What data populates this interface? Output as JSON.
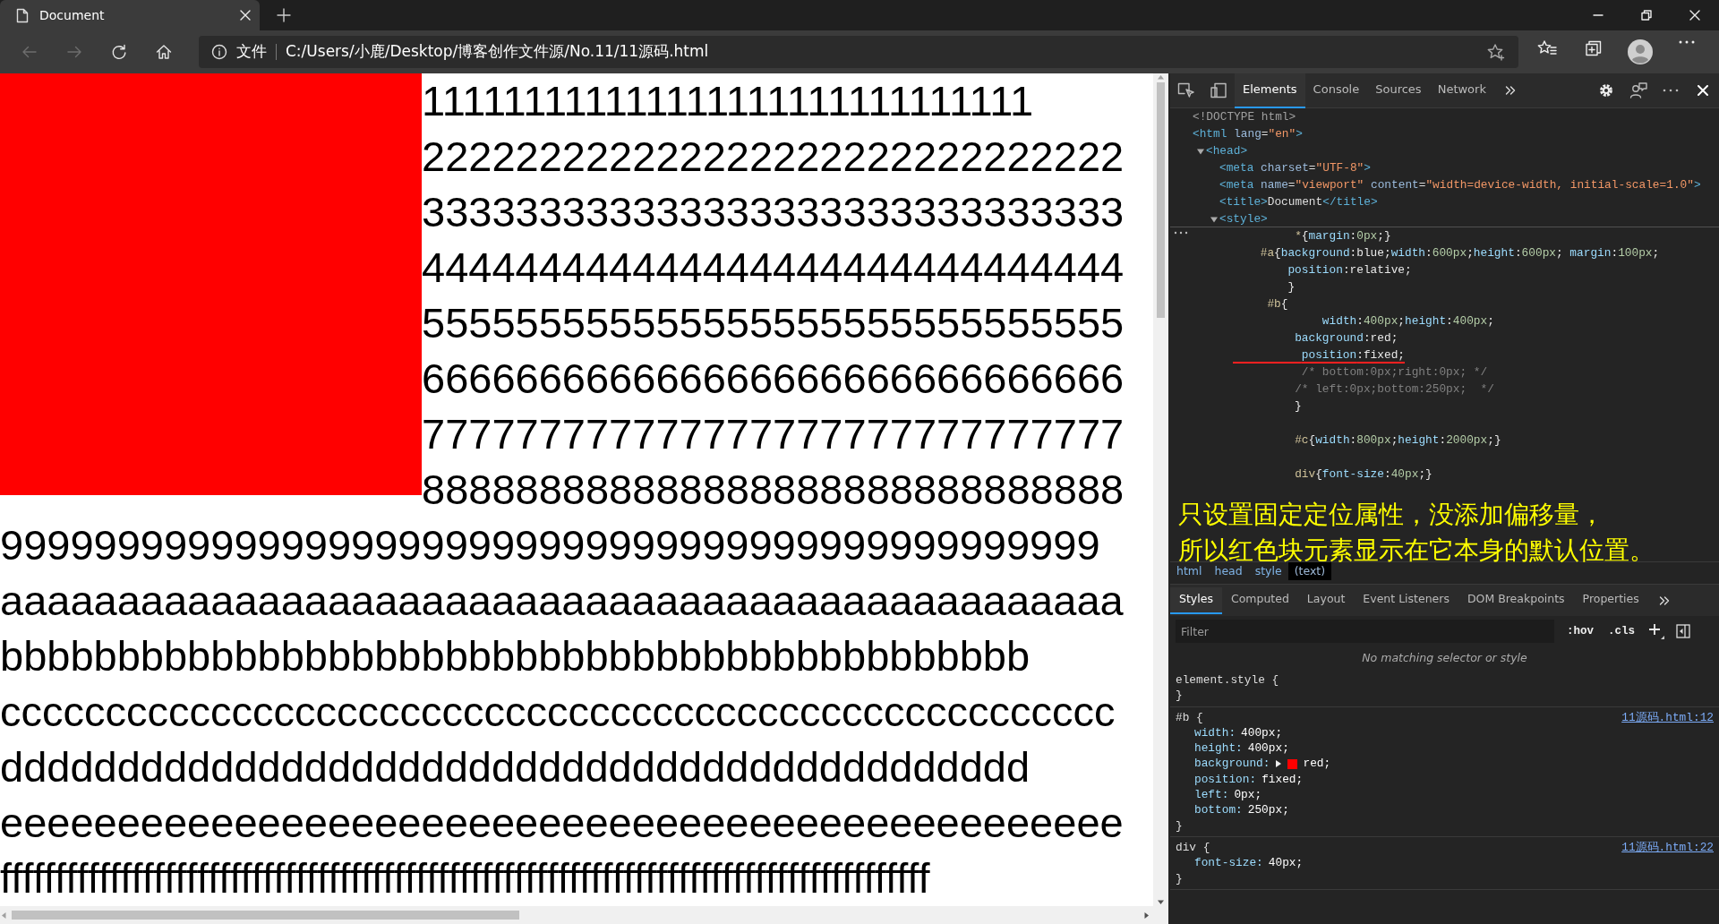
{
  "browser": {
    "tabs": [
      {
        "title": "Document",
        "selected": true
      }
    ],
    "nav": [
      {
        "kind": "back",
        "disabled": true
      },
      {
        "kind": "forward",
        "disabled": true
      },
      {
        "kind": "refresh",
        "disabled": false
      },
      {
        "kind": "home",
        "disabled": false
      }
    ],
    "address": {
      "security_label": "文件",
      "url": "C:/Users/小鹿/Desktop/博客创作文件源/No.11/11源码.html"
    }
  },
  "page": {
    "lines": [
      {
        "text": "111111111111111111111111111111",
        "covered": true
      },
      {
        "text": "222222222222222222222222222222",
        "covered": true
      },
      {
        "text": "333333333333333333333333333333",
        "covered": true
      },
      {
        "text": "444444444444444444444444444444",
        "covered": true
      },
      {
        "text": "555555555555555555555555555555",
        "covered": true
      },
      {
        "text": "666666666666666666666666666666",
        "covered": true
      },
      {
        "text": "777777777777777777777777777777",
        "covered": true
      },
      {
        "text": "888888888888888888888888888888",
        "covered": true
      },
      {
        "text": "99999999999999999999999999999999999999999999999",
        "covered": false
      },
      {
        "text": "aaaaaaaaaaaaaaaaaaaaaaaaaaaaaaaaaaaaaaaaaaaaaaaa",
        "covered": false
      },
      {
        "text": "bbbbbbbbbbbbbbbbbbbbbbbbbbbbbbbbbbbbbbbbbbbb",
        "covered": false
      },
      {
        "text": "ccccccccccccccccccccccccccccccccccccccccccccccccccccc",
        "covered": false
      },
      {
        "text": "dddddddddddddddddddddddddddddddddddddddddddd",
        "covered": false
      },
      {
        "text": "eeeeeeeeeeeeeeeeeeeeeeeeeeeeeeeeeeeeeeeeeeeeeeee",
        "covered": false
      },
      {
        "text": "fffffffffffffffffffffffffffffffffffffffffffffffffffffffffffffffffffffffffffffffffffff",
        "covered": false
      }
    ]
  },
  "devtools": {
    "tabs": [
      {
        "label": "Elements",
        "selected": true
      },
      {
        "label": "Console",
        "selected": false
      },
      {
        "label": "Sources",
        "selected": false
      },
      {
        "label": "Network",
        "selected": false
      }
    ],
    "dom": [
      {
        "kind": "doctype",
        "markup": "<!DOCTYPE html>"
      },
      {
        "kind": "element",
        "markup": "<html lang=\"en\">",
        "children": [
          {
            "kind": "element",
            "markup": "<head>",
            "expanded": true,
            "children": [
              {
                "kind": "element",
                "markup": "<meta charset=\"UTF-8\">"
              },
              {
                "kind": "element",
                "markup": "<meta name=\"viewport\" content=\"width=device-width, initial-scale=1.0\">"
              },
              {
                "kind": "element",
                "markup": "<title>Document</title>"
              },
              {
                "kind": "element",
                "markup": "<style>",
                "expanded": true,
                "children": [
                  {
                    "kind": "text",
                    "selected": true,
                    "lines": [
                      {
                        "text": "         *{margin:0px;}",
                        "underlined": false,
                        "blank_after": false
                      },
                      {
                        "text": "    #a{background:blue;width:600px;height:600px; margin:100px;",
                        "underlined": false,
                        "blank_after": false
                      },
                      {
                        "text": "        position:relative;",
                        "underlined": false,
                        "blank_after": false
                      },
                      {
                        "text": "        }",
                        "underlined": false,
                        "blank_after": false
                      },
                      {
                        "text": "     #b{",
                        "underlined": false,
                        "blank_after": false
                      },
                      {
                        "text": "             width:400px;height:400px;",
                        "underlined": false,
                        "blank_after": false
                      },
                      {
                        "text": "         background:red;",
                        "underlined": false,
                        "blank_after": false
                      },
                      {
                        "text": "          position:fixed;",
                        "underlined": true,
                        "blank_after": false
                      },
                      {
                        "text": "          /* bottom:0px;right:0px; */",
                        "underlined": false,
                        "blank_after": false
                      },
                      {
                        "text": "         /* left:0px;bottom:250px;  */",
                        "underlined": false,
                        "blank_after": false
                      },
                      {
                        "text": "         }",
                        "underlined": false,
                        "blank_after": true
                      },
                      {
                        "text": "         #c{width:800px;height:2000px;}",
                        "underlined": false,
                        "blank_after": true
                      },
                      {
                        "text": "         div{font-size:40px;}",
                        "underlined": false,
                        "blank_after": false
                      }
                    ]
                  }
                ]
              }
            ]
          }
        ]
      }
    ],
    "annotation": {
      "lines": [
        "只设置固定定位属性，没添加偏移量，",
        "所以红色块元素显示在它本身的默认位置。"
      ]
    },
    "breadcrumbs": [
      {
        "label": "html",
        "selected": false
      },
      {
        "label": "head",
        "selected": false
      },
      {
        "label": "style",
        "selected": false
      },
      {
        "label": "(text)",
        "selected": true
      }
    ],
    "styles": {
      "tabs": [
        {
          "label": "Styles",
          "selected": true
        },
        {
          "label": "Computed",
          "selected": false
        },
        {
          "label": "Layout",
          "selected": false
        },
        {
          "label": "Event Listeners",
          "selected": false
        },
        {
          "label": "DOM Breakpoints",
          "selected": false
        },
        {
          "label": "Properties",
          "selected": false
        }
      ],
      "filter": {
        "placeholder": "Filter"
      },
      "toggles": [
        ":hov",
        ".cls"
      ],
      "message": "No matching selector or style",
      "rules": [
        {
          "selector": "element.style {",
          "close": "}"
        },
        {
          "selector": "#b {",
          "source": "11源码.html:12",
          "close": "}",
          "declarations": [
            {
              "name": "width:",
              "value": "400px;"
            },
            {
              "name": "height:",
              "value": "400px;"
            },
            {
              "name": "background:",
              "value": "red;",
              "color": "#ff0000"
            },
            {
              "name": "position:",
              "value": "fixed;"
            },
            {
              "name": "left:",
              "value": "0px;"
            },
            {
              "name": "bottom:",
              "value": "250px;"
            }
          ]
        },
        {
          "selector": "div {",
          "source": "11源码.html:22",
          "close": "}",
          "declarations": [
            {
              "name": "font-size:",
              "value": "40px;"
            }
          ]
        }
      ]
    }
  }
}
